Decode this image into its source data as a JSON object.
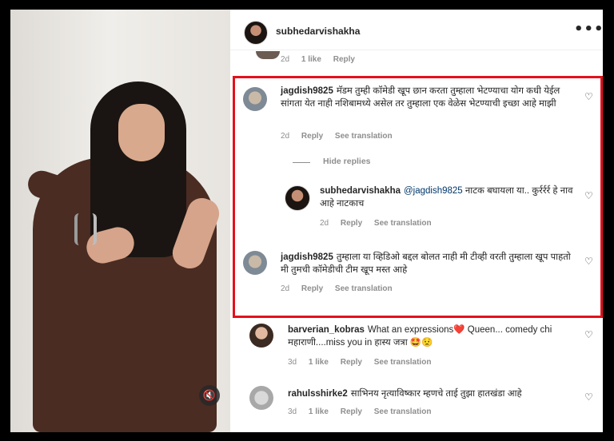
{
  "header": {
    "username": "subhedarvishakha",
    "more_icon": "•••"
  },
  "top_meta": {
    "time": "2d",
    "likes": "1 like",
    "reply": "Reply"
  },
  "video": {
    "mute_icon": "🔇"
  },
  "comments": [
    {
      "user": "jagdish9825",
      "text": "मॅडम तुम्ही कॉमेडी खूप छान करता तुम्हाला भेटण्याचा योग कधी येईल सांगता येत नाही नशिबामध्ये असेल तर तुम्हाला एक वेळेस भेटण्याची इच्छा आहे माझी",
      "time": "2d",
      "reply": "Reply",
      "translation": "See translation"
    },
    {
      "user": "subhedarvishakha",
      "mention": "@jagdish9825",
      "text": "नाटक बघायला या.. कुर्रर्रर्र हे नाव आहे नाटकाच",
      "time": "2d",
      "reply": "Reply",
      "translation": "See translation"
    },
    {
      "user": "jagdish9825",
      "text": "तुम्हाला या व्हिडिओ बद्दल बोलत नाही मी टीव्ही वरती तुम्हाला खूप पाहतो मी तुमची कॉमेडीची टीम खूप मस्त आहे",
      "time": "2d",
      "reply": "Reply",
      "translation": "See translation"
    },
    {
      "user": "barverian_kobras",
      "text": "What an expressions❤️ Queen... comedy chi महाराणी....miss you in हास्य जत्रा 🤩😟",
      "time": "3d",
      "likes": "1 like",
      "reply": "Reply",
      "translation": "See translation"
    },
    {
      "user": "rahulsshirke2",
      "text": "साभिनय नृत्याविष्कार म्हणचे ताई तुझा हातखंडा आहे",
      "time": "3d",
      "likes": "1 like",
      "reply": "Reply",
      "translation": "See translation"
    }
  ],
  "hide_replies": "Hide replies",
  "heart_icon": "♡",
  "accent_color": "#e3111d"
}
